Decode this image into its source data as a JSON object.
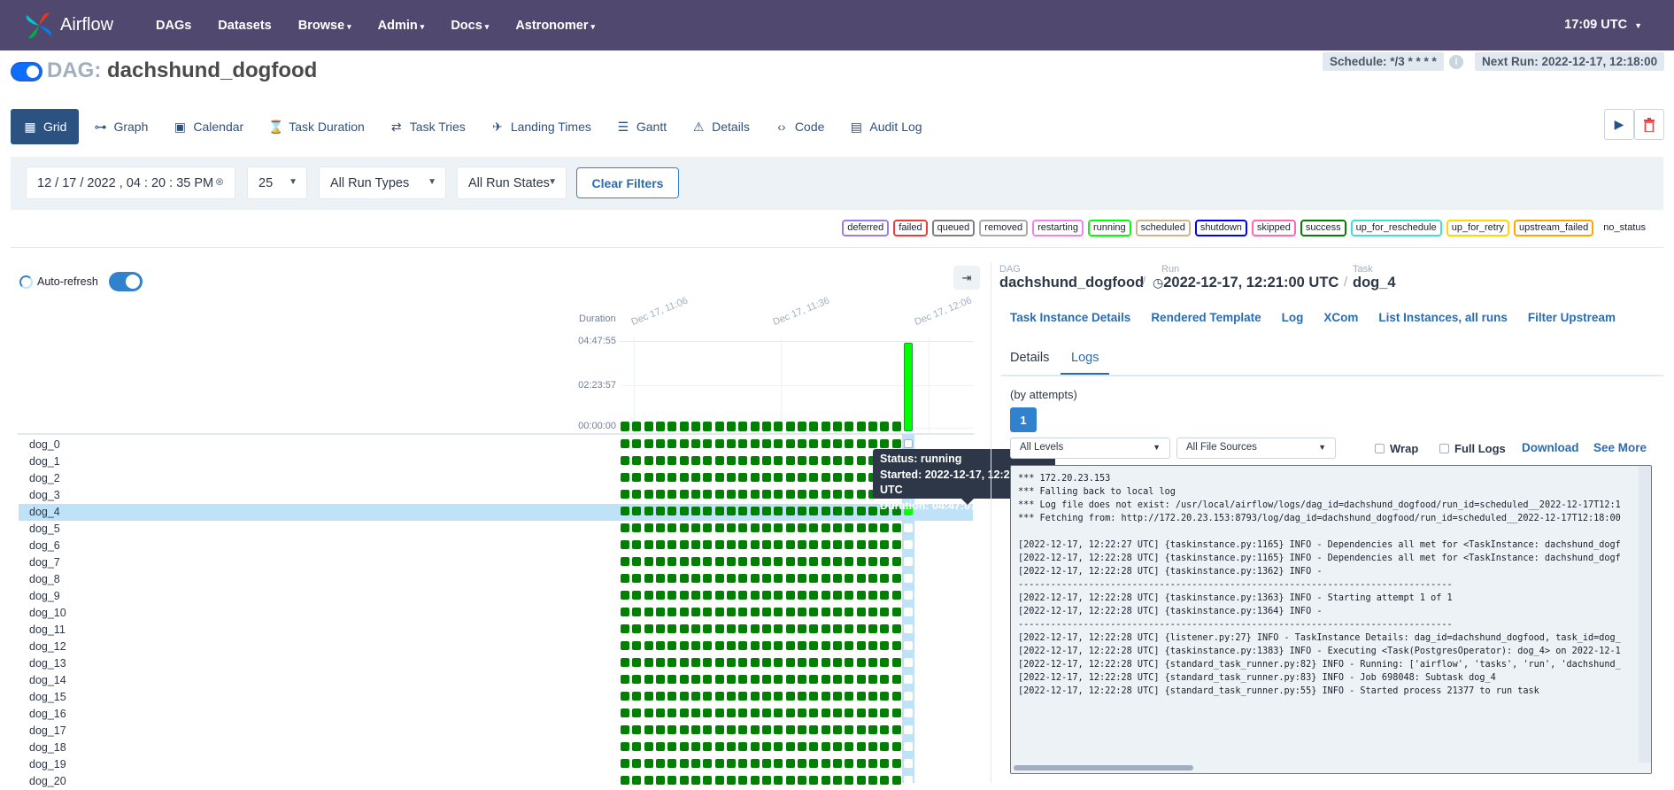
{
  "nav": {
    "logo_text": "Airflow",
    "items": [
      {
        "label": "DAGs",
        "caret": false
      },
      {
        "label": "Datasets",
        "caret": false
      },
      {
        "label": "Browse",
        "caret": true
      },
      {
        "label": "Admin",
        "caret": true
      },
      {
        "label": "Docs",
        "caret": true
      },
      {
        "label": "Astronomer",
        "caret": true
      }
    ],
    "time": "17:09 UTC"
  },
  "dag": {
    "prefix": "DAG:",
    "name": "dachshund_dogfood",
    "schedule": "Schedule: */3 * * * *",
    "next_run": "Next Run: 2022-12-17, 12:18:00",
    "active": true
  },
  "tabs": [
    {
      "label": "Grid",
      "icon": "grid-icon",
      "glyph": "▦",
      "active": true
    },
    {
      "label": "Graph",
      "icon": "graph-icon",
      "glyph": "⊶",
      "active": false
    },
    {
      "label": "Calendar",
      "icon": "calendar-icon",
      "glyph": "▣",
      "active": false
    },
    {
      "label": "Task Duration",
      "icon": "hourglass-icon",
      "glyph": "⌛",
      "active": false
    },
    {
      "label": "Task Tries",
      "icon": "retry-icon",
      "glyph": "⇄",
      "active": false
    },
    {
      "label": "Landing Times",
      "icon": "landing-icon",
      "glyph": "✈",
      "active": false
    },
    {
      "label": "Gantt",
      "icon": "gantt-icon",
      "glyph": "☰",
      "active": false
    },
    {
      "label": "Details",
      "icon": "warning-icon",
      "glyph": "⚠",
      "active": false
    },
    {
      "label": "Code",
      "icon": "code-icon",
      "glyph": "‹›",
      "active": false
    },
    {
      "label": "Audit Log",
      "icon": "audit-log-icon",
      "glyph": "▤",
      "active": false
    }
  ],
  "filters": {
    "datetime": "12 / 17 / 2022 ,  04 : 20 : 35   PM",
    "limit": "25",
    "run_types": "All Run Types",
    "run_states": "All Run States",
    "clear_label": "Clear Filters"
  },
  "legend": [
    {
      "label": "deferred",
      "color": "#9f7aea"
    },
    {
      "label": "failed",
      "color": "#e53e3e"
    },
    {
      "label": "queued",
      "color": "#808080"
    },
    {
      "label": "removed",
      "color": "#a9a9a9"
    },
    {
      "label": "restarting",
      "color": "#ee82ee"
    },
    {
      "label": "running",
      "color": "#00ff00"
    },
    {
      "label": "scheduled",
      "color": "#d2b48c"
    },
    {
      "label": "shutdown",
      "color": "#0000ff"
    },
    {
      "label": "skipped",
      "color": "#ff69b4"
    },
    {
      "label": "success",
      "color": "#008000"
    },
    {
      "label": "up_for_reschedule",
      "color": "#40e0d0"
    },
    {
      "label": "up_for_retry",
      "color": "#ffd700"
    },
    {
      "label": "upstream_failed",
      "color": "#ffa500"
    },
    {
      "label": "no_status",
      "color": ""
    }
  ],
  "grid": {
    "auto_refresh_label": "Auto-refresh",
    "duration_label": "Duration",
    "y_ticks": [
      "04:47:55",
      "02:23:57",
      "00:00:00"
    ],
    "x_dates": [
      "Dec 17, 11:06",
      "Dec 17, 11:36",
      "Dec 17, 12:06"
    ],
    "num_runs": 25,
    "selected_task": "dog_4",
    "tasks": [
      "dog_0",
      "dog_1",
      "dog_2",
      "dog_3",
      "dog_4",
      "dog_5",
      "dog_6",
      "dog_7",
      "dog_8",
      "dog_9",
      "dog_10",
      "dog_11",
      "dog_12",
      "dog_13",
      "dog_14",
      "dog_15",
      "dog_16",
      "dog_17",
      "dog_18",
      "dog_19",
      "dog_20"
    ],
    "tooltip": {
      "status": "Status: running",
      "started": "Started: 2022-12-17, 12:22:27 UTC",
      "duration": "Duration: 04:47:07"
    }
  },
  "details": {
    "crumb": {
      "dag_small": "DAG",
      "dag": "dachshund_dogfood",
      "run_small": "Run",
      "run": "2022-12-17, 12:21:00 UTC",
      "task_small": "Task",
      "task": "dog_4"
    },
    "ti_tabs": [
      "Task Instance Details",
      "Rendered Template",
      "Log",
      "XCom",
      "List Instances, all runs",
      "Filter Upstream"
    ],
    "sub_tabs": {
      "details": "Details",
      "logs": "Logs"
    },
    "by_attempts": "(by attempts)",
    "attempt": "1",
    "levels_select": "All Levels",
    "sources_select": "All File Sources",
    "wrap_label": "Wrap",
    "full_logs_label": "Full Logs",
    "download_label": "Download",
    "see_more_label": "See More",
    "log_lines": [
      "*** 172.20.23.153",
      "*** Falling back to local log",
      "*** Log file does not exist: /usr/local/airflow/logs/dag_id=dachshund_dogfood/run_id=scheduled__2022-12-17T12:1",
      "*** Fetching from: http://172.20.23.153:8793/log/dag_id=dachshund_dogfood/run_id=scheduled__2022-12-17T12:18:00",
      "",
      "[2022-12-17, 12:22:27 UTC] {taskinstance.py:1165} INFO - Dependencies all met for <TaskInstance: dachshund_dogf",
      "[2022-12-17, 12:22:28 UTC] {taskinstance.py:1165} INFO - Dependencies all met for <TaskInstance: dachshund_dogf",
      "[2022-12-17, 12:22:28 UTC] {taskinstance.py:1362} INFO -",
      "--------------------------------------------------------------------------------",
      "[2022-12-17, 12:22:28 UTC] {taskinstance.py:1363} INFO - Starting attempt 1 of 1",
      "[2022-12-17, 12:22:28 UTC] {taskinstance.py:1364} INFO -",
      "--------------------------------------------------------------------------------",
      "[2022-12-17, 12:22:28 UTC] {listener.py:27} INFO - TaskInstance Details: dag_id=dachshund_dogfood, task_id=dog_",
      "[2022-12-17, 12:22:28 UTC] {taskinstance.py:1383} INFO - Executing <Task(PostgresOperator): dog_4> on 2022-12-1",
      "[2022-12-17, 12:22:28 UTC] {standard_task_runner.py:82} INFO - Running: ['airflow', 'tasks', 'run', 'dachshund_",
      "[2022-12-17, 12:22:28 UTC] {standard_task_runner.py:83} INFO - Job 698048: Subtask dog_4",
      "[2022-12-17, 12:22:28 UTC] {standard_task_runner.py:55} INFO - Started process 21377 to run task"
    ]
  }
}
